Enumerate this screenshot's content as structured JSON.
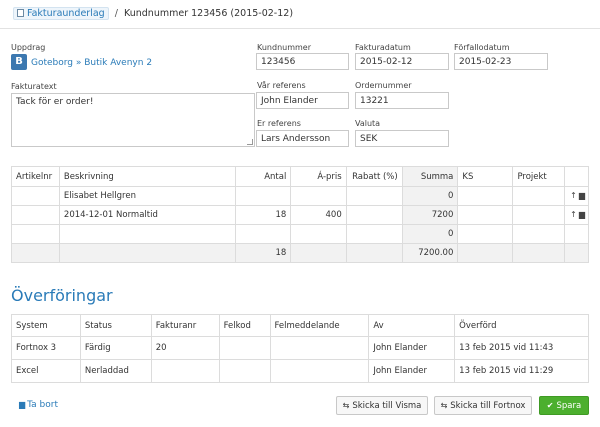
{
  "breadcrumb": {
    "link_label": "Fakturaunderlag",
    "separator": "/",
    "current": "Kundnummer 123456 (2015-02-12)"
  },
  "form": {
    "uppdrag": {
      "label": "Uppdrag",
      "badge": "B",
      "value": "Goteborg » Butik Avenyn 2"
    },
    "kundnummer": {
      "label": "Kundnummer",
      "value": "123456"
    },
    "fakturadatum": {
      "label": "Fakturadatum",
      "value": "2015-02-12"
    },
    "forfallodatum": {
      "label": "Förfallodatum",
      "value": "2015-02-23"
    },
    "fakturatext": {
      "label": "Fakturatext",
      "value": "Tack för er order!"
    },
    "var_referens": {
      "label": "Vår referens",
      "value": "John Elander"
    },
    "ordernummer": {
      "label": "Ordernummer",
      "value": "13221"
    },
    "er_referens": {
      "label": "Er referens",
      "value": "Lars Andersson"
    },
    "valuta": {
      "label": "Valuta",
      "value": "SEK"
    }
  },
  "rows_table": {
    "headers": [
      "Artikelnr",
      "Beskrivning",
      "Antal",
      "Á-pris",
      "Rabatt (%)",
      "Summa",
      "KS",
      "Projekt"
    ],
    "rows": [
      {
        "artikelnr": "",
        "beskrivning": "Elisabet Hellgren",
        "antal": "",
        "apris": "",
        "rabatt": "",
        "summa": "0",
        "ks": "",
        "projekt": ""
      },
      {
        "artikelnr": "",
        "beskrivning": "2014-12-01 Normaltid",
        "antal": "18",
        "apris": "400",
        "rabatt": "",
        "summa": "7200",
        "ks": "",
        "projekt": ""
      },
      {
        "artikelnr": "",
        "beskrivning": "",
        "antal": "",
        "apris": "",
        "rabatt": "",
        "summa": "0",
        "ks": "",
        "projekt": ""
      }
    ],
    "totals": {
      "antal": "18",
      "summa": "7200.00"
    }
  },
  "transfers": {
    "title": "Överföringar",
    "headers": [
      "System",
      "Status",
      "Fakturanr",
      "Felkod",
      "Felmeddelande",
      "Av",
      "Överförd"
    ],
    "rows": [
      {
        "system": "Fortnox 3",
        "status": "Färdig",
        "fakturanr": "20",
        "felkod": "",
        "felmeddelande": "",
        "av": "John Elander",
        "overford": "13 feb 2015 vid 11:43"
      },
      {
        "system": "Excel",
        "status": "Nerladdad",
        "fakturanr": "",
        "felkod": "",
        "felmeddelande": "",
        "av": "John Elander",
        "overford": "13 feb 2015 vid 11:29"
      }
    ]
  },
  "actions": {
    "delete": "Ta bort",
    "send_visma": "Skicka till Visma",
    "send_fortnox": "Skicka till Fortnox",
    "save": "Spara"
  }
}
